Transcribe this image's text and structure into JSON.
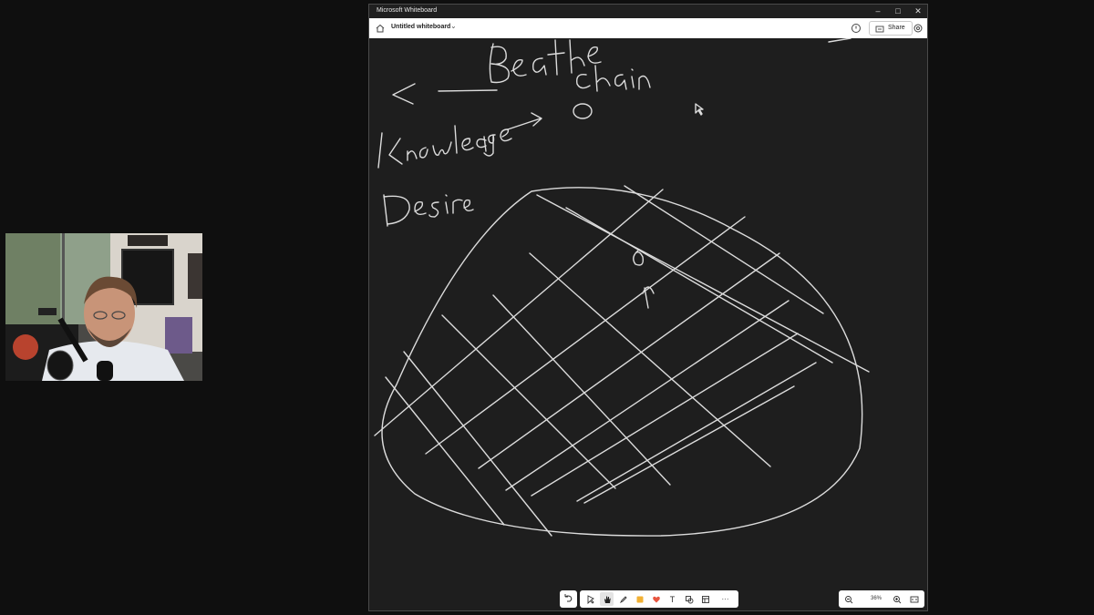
{
  "window": {
    "app_title": "Microsoft Whiteboard",
    "board_title": "Untitled whiteboard",
    "share_label": "Share",
    "controls": {
      "minimize": "–",
      "maximize": "□",
      "close": "✕"
    }
  },
  "toolbar": {
    "tools": [
      {
        "name": "undo-icon"
      },
      {
        "name": "select-icon"
      },
      {
        "name": "hand-pan-icon",
        "active": true
      },
      {
        "name": "pen-icon"
      },
      {
        "name": "sticky-note-icon",
        "color": "#f2b134"
      },
      {
        "name": "reaction-heart-icon",
        "color": "#e8553f"
      },
      {
        "name": "text-icon",
        "glyph": "T"
      },
      {
        "name": "shapes-icon"
      },
      {
        "name": "templates-icon"
      },
      {
        "name": "more-icon",
        "glyph": "···"
      }
    ]
  },
  "zoom": {
    "value": "36%",
    "zoom_out": "−",
    "zoom_in": "+"
  },
  "colors": {
    "canvas": "#1e1e1e",
    "ink": "#dcdcdc",
    "background": "#0f0f0f"
  }
}
